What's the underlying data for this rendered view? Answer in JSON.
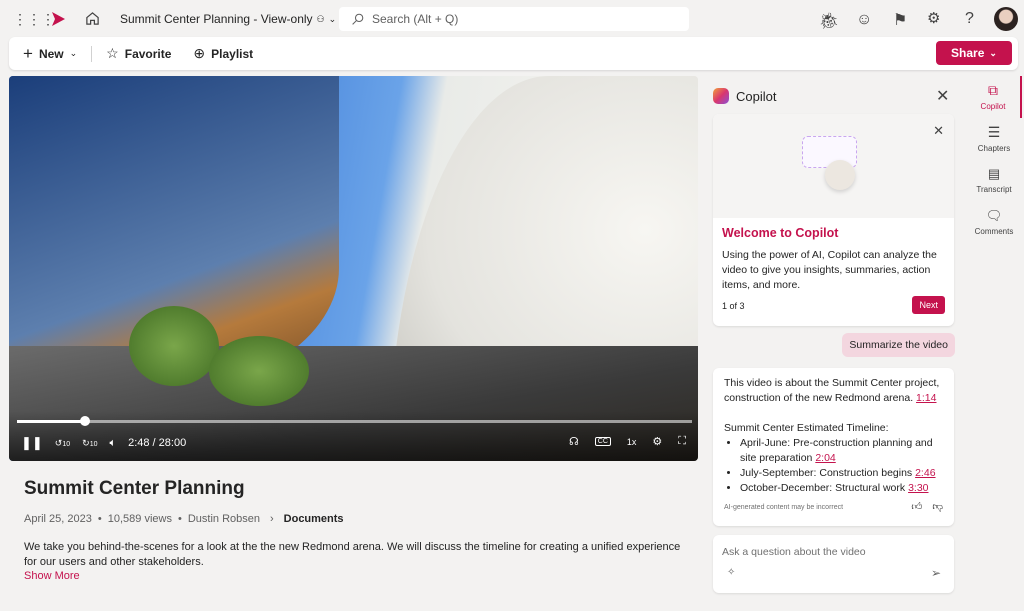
{
  "header": {
    "title": "Summit Center Planning - View-only",
    "search_placeholder": "Search (Alt + Q)"
  },
  "toolbar": {
    "new": "New",
    "favorite": "Favorite",
    "playlist": "Playlist",
    "share": "Share"
  },
  "player": {
    "time": "2:48 / 28:00",
    "progress_percent": 10,
    "speed": "1x",
    "skip": "10"
  },
  "video": {
    "title": "Summit Center Planning",
    "date": "April 25, 2023",
    "views": "10,589 views",
    "author": "Dustin Robsen",
    "location": "Documents",
    "description": "We take you behind-the-scenes for a look at the the new Redmond arena. We will discuss the timeline for creating a unified experience for our users and other stakeholders.",
    "show_more": "Show More"
  },
  "copilot": {
    "title": "Copilot",
    "welcome_title": "Welcome to Copilot",
    "welcome_body": "Using the power of AI, Copilot can analyze the video to give you insights, summaries, action items, and more.",
    "pager": "1 of 3",
    "next": "Next",
    "user_prompt": "Summarize the video",
    "response": {
      "intro": "This video is about the Summit Center project, construction of the new Redmond arena.",
      "intro_ts": "1:14",
      "heading": "Summit Center Estimated Timeline:",
      "items": [
        {
          "text": "April-June: Pre-construction planning and site preparation",
          "ts": "2:04"
        },
        {
          "text": "July-September: Construction begins",
          "ts": "2:46"
        },
        {
          "text": "October-December: Structural work",
          "ts": "3:30"
        }
      ],
      "disclaimer": "AI-generated content may be incorrect"
    },
    "input_placeholder": "Ask a question about the video"
  },
  "rail": [
    {
      "label": "Copilot"
    },
    {
      "label": "Chapters"
    },
    {
      "label": "Transcript"
    },
    {
      "label": "Comments"
    }
  ],
  "colors": {
    "accent": "#c4124d",
    "prompt_bubble": "#f3d6df"
  }
}
